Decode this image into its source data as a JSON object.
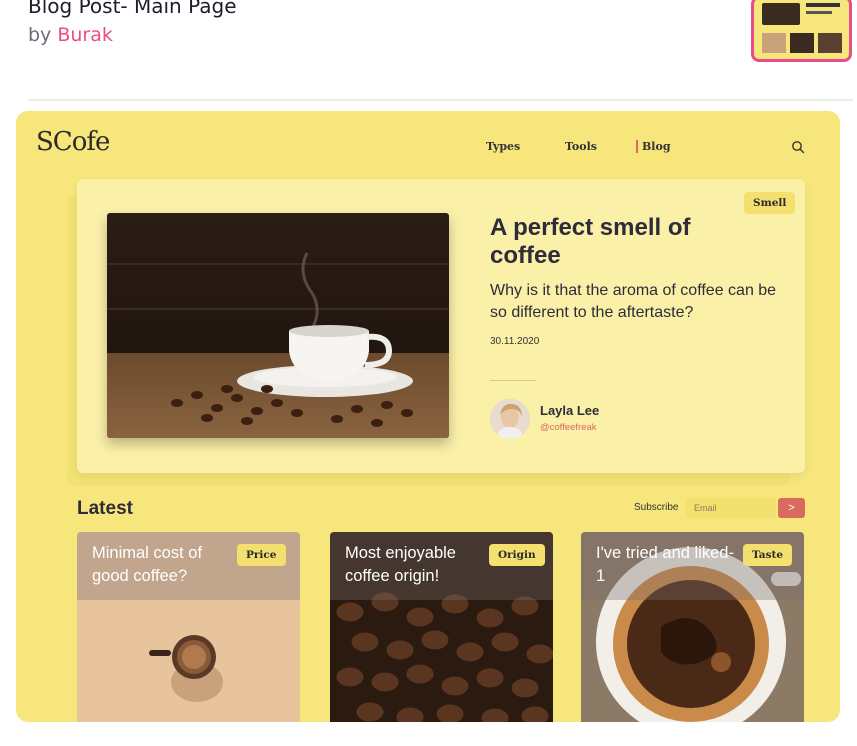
{
  "header": {
    "title": "Blog Post- Main Page",
    "by": "by",
    "author": "Burak"
  },
  "site": {
    "logo": "SCofe",
    "nav": [
      "Types",
      "Tools",
      "Blog"
    ]
  },
  "hero": {
    "tag": "Smell",
    "title": "A perfect smell of coffee",
    "subtitle": "Why is it that the aroma of coffee can be so different to the aftertaste?",
    "date": "30.11.2020",
    "author_name": "Layla Lee",
    "author_handle": "@coffeefreak"
  },
  "latest": {
    "heading": "Latest",
    "subscribe_label": "Subscribe",
    "email_placeholder": "Email",
    "go_label": ">",
    "cards": [
      {
        "title": "Minimal cost of good coffee?",
        "tag": "Price"
      },
      {
        "title": "Most enjoyable coffee origin!",
        "tag": "Origin"
      },
      {
        "title": "I've tried and liked-1",
        "tag": "Taste"
      }
    ]
  },
  "colors": {
    "brand_yellow": "#f6e67c",
    "accent_coral": "#d96a5c",
    "dribbble_pink": "#ea4c89"
  }
}
